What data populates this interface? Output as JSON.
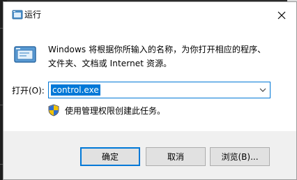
{
  "window": {
    "title": "运行",
    "close_label": "×"
  },
  "dialog": {
    "description": "Windows 将根据你所输入的名称，为你打开相应的程序、文件夹、文档或 Internet 资源。",
    "open_label": "打开(O):",
    "open_value": "control.exe",
    "admin_note": "使用管理权限创建此任务。"
  },
  "buttons": {
    "ok": "确定",
    "cancel": "取消",
    "browse": "浏览(B)..."
  },
  "icons": {
    "title": "run-icon",
    "run": "run-icon",
    "shield": "uac-shield-icon",
    "dropdown": "chevron-down-icon",
    "close": "close-icon"
  },
  "colors": {
    "accent": "#0078d7",
    "footer": "#f0f0f0"
  }
}
